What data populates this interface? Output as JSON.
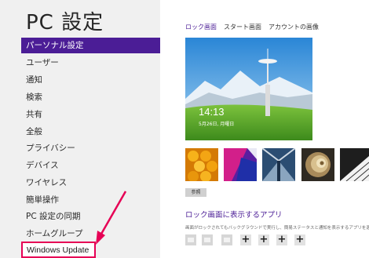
{
  "sidebar": {
    "title": "PC 設定",
    "items": [
      {
        "label": "パーソナル設定",
        "selected": true
      },
      {
        "label": "ユーザー"
      },
      {
        "label": "通知"
      },
      {
        "label": "検索"
      },
      {
        "label": "共有"
      },
      {
        "label": "全般"
      },
      {
        "label": "プライバシー"
      },
      {
        "label": "デバイス"
      },
      {
        "label": "ワイヤレス"
      },
      {
        "label": "簡単操作"
      },
      {
        "label": "PC 設定の同期"
      },
      {
        "label": "ホームグループ"
      },
      {
        "label": "Windows Update",
        "highlighted": true
      }
    ]
  },
  "main": {
    "tabs": [
      {
        "label": "ロック画面",
        "active": true
      },
      {
        "label": "スタート画面"
      },
      {
        "label": "アカウントの画像"
      }
    ],
    "lockscreen": {
      "time": "14:13",
      "date": "5月26日, 月曜日"
    },
    "browse_label": "参照",
    "apps_section": {
      "title": "ロック画面に表示するアプリ",
      "description": "画面がロックされてもバックグラウンドで実行し、簡易ステータスと通知を表示するアプリを選びます"
    }
  },
  "colors": {
    "accent": "#4b1d96",
    "highlight_border": "#e60055",
    "sidebar_bg": "#f0f0f0"
  }
}
